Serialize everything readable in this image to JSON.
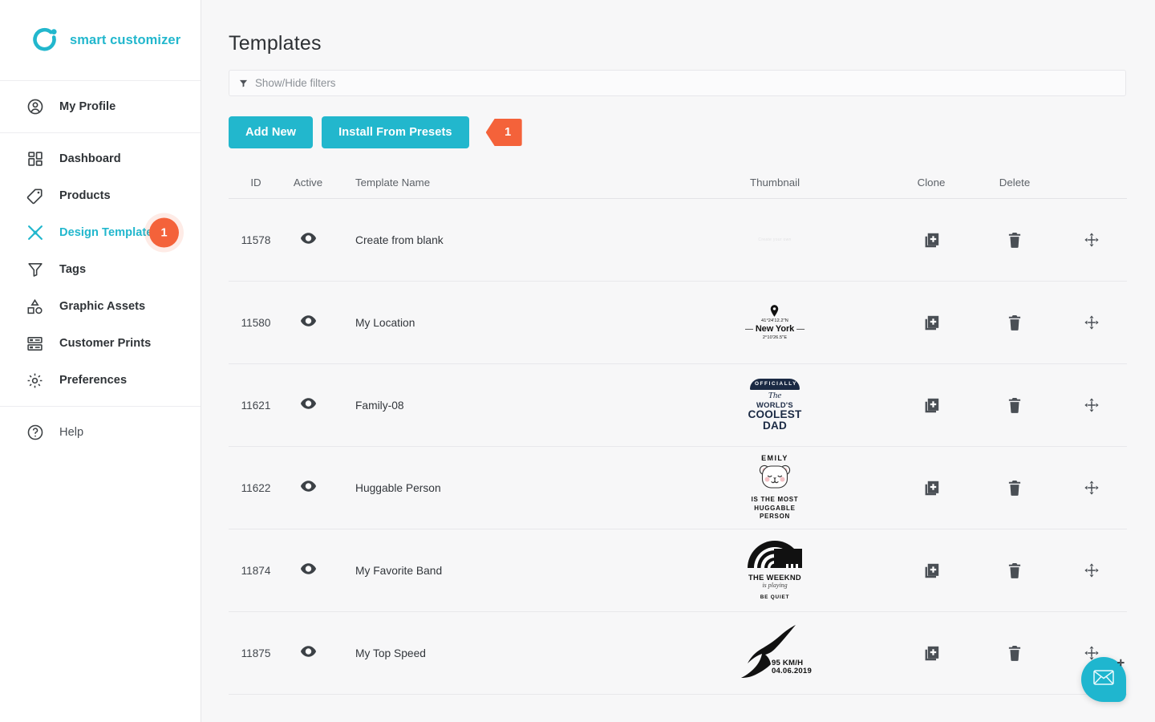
{
  "brand": {
    "name": "smart customizer",
    "logo_icon": "circle-dot-logo-icon",
    "accent": "#22b7cd"
  },
  "sidebar": {
    "profile_group": [
      {
        "label": "My Profile",
        "icon": "user-circle-icon"
      }
    ],
    "items": [
      {
        "label": "Dashboard",
        "icon": "dashboard-grid-icon",
        "active": false,
        "badge": null
      },
      {
        "label": "Products",
        "icon": "tag-icon",
        "active": false,
        "badge": null
      },
      {
        "label": "Design Templates",
        "icon": "scissors-icon",
        "active": true,
        "badge": "1"
      },
      {
        "label": "Tags",
        "icon": "funnel-icon",
        "active": false,
        "badge": null
      },
      {
        "label": "Graphic Assets",
        "icon": "shapes-icon",
        "active": false,
        "badge": null
      },
      {
        "label": "Customer Prints",
        "icon": "print-rows-icon",
        "active": false,
        "badge": null
      },
      {
        "label": "Preferences",
        "icon": "gear-icon",
        "active": false,
        "badge": null
      }
    ],
    "help": {
      "label": "Help",
      "icon": "question-circle-icon"
    }
  },
  "main": {
    "title": "Templates",
    "filter": {
      "label": "Show/Hide filters",
      "icon": "funnel-icon"
    },
    "buttons": {
      "add_new": "Add New",
      "install_presets": "Install From Presets",
      "callout_badge": "1",
      "badge_color": "#f4623a"
    },
    "table": {
      "headers": {
        "id": "ID",
        "active": "Active",
        "name": "Template Name",
        "thumbnail": "Thumbnail",
        "clone": "Clone",
        "delete": "Delete"
      },
      "rows": [
        {
          "id": "11578",
          "name": "Create from blank",
          "active_icon": "eye-icon",
          "clone_icon": "copy-plus-icon",
          "delete_icon": "trash-icon",
          "move_icon": "move-arrows-icon",
          "thumb": {
            "kind": "blank",
            "text": "Create your own"
          }
        },
        {
          "id": "11580",
          "name": "My Location",
          "active_icon": "eye-icon",
          "clone_icon": "copy-plus-icon",
          "delete_icon": "trash-icon",
          "move_icon": "move-arrows-icon",
          "thumb": {
            "kind": "location",
            "lat": "41°24'12.2\"N",
            "city": "New York",
            "lon": "2°10'26.5\"E"
          }
        },
        {
          "id": "11621",
          "name": "Family-08",
          "active_icon": "eye-icon",
          "clone_icon": "copy-plus-icon",
          "delete_icon": "trash-icon",
          "move_icon": "move-arrows-icon",
          "thumb": {
            "kind": "coolest-dad",
            "ribbon": "OFFICIALLY",
            "the": "The",
            "worlds": "WORLD'S",
            "coolest": "COOLEST",
            "dad": "DAD"
          }
        },
        {
          "id": "11622",
          "name": "Huggable Person",
          "active_icon": "eye-icon",
          "clone_icon": "copy-plus-icon",
          "delete_icon": "trash-icon",
          "move_icon": "move-arrows-icon",
          "thumb": {
            "kind": "huggable",
            "name": "EMILY",
            "line1": "IS THE MOST HUGGABLE",
            "line2": "PERSON"
          }
        },
        {
          "id": "11874",
          "name": "My Favorite Band",
          "active_icon": "eye-icon",
          "clone_icon": "copy-plus-icon",
          "delete_icon": "trash-icon",
          "move_icon": "move-arrows-icon",
          "thumb": {
            "kind": "band",
            "band": "THE WEEKND",
            "script": "is playing",
            "footer": "BE QUIET"
          }
        },
        {
          "id": "11875",
          "name": "My Top Speed",
          "active_icon": "eye-icon",
          "clone_icon": "copy-plus-icon",
          "delete_icon": "trash-icon",
          "move_icon": "move-arrows-icon",
          "thumb": {
            "kind": "speed",
            "speed": "95 KM/H",
            "date": "04.06.2019"
          }
        }
      ]
    },
    "chat_fab": {
      "icon": "envelope-chat-icon",
      "color": "#1fb6cf"
    }
  }
}
